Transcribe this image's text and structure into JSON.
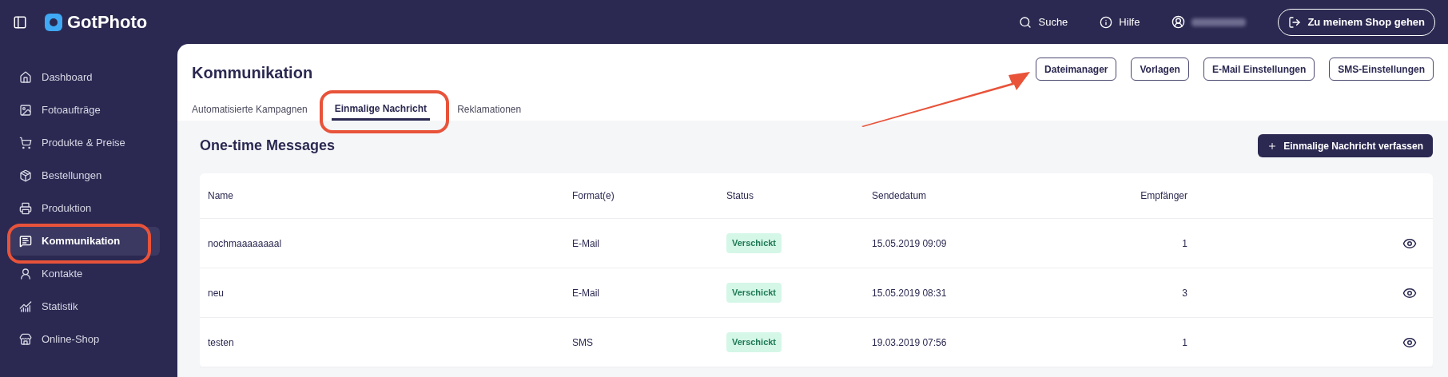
{
  "topbar": {
    "brand": "GotPhoto",
    "search": "Suche",
    "help": "Hilfe",
    "shop_button": "Zu meinem Shop gehen"
  },
  "sidebar": {
    "items": [
      {
        "label": "Dashboard",
        "selected": false
      },
      {
        "label": "Fotoaufträge",
        "selected": false
      },
      {
        "label": "Produkte & Preise",
        "selected": false
      },
      {
        "label": "Bestellungen",
        "selected": false
      },
      {
        "label": "Produktion",
        "selected": false
      },
      {
        "label": "Kommunikation",
        "selected": true
      },
      {
        "label": "Kontakte",
        "selected": false
      },
      {
        "label": "Statistik",
        "selected": false
      },
      {
        "label": "Online-Shop",
        "selected": false
      }
    ]
  },
  "page": {
    "title": "Kommunikation",
    "actions": [
      "Dateimanager",
      "Vorlagen",
      "E-Mail Einstellungen",
      "SMS-Einstellungen"
    ],
    "tabs": [
      {
        "label": "Automatisierte Kampagnen",
        "selected": false
      },
      {
        "label": "Einmalige Nachricht",
        "selected": true
      },
      {
        "label": "Reklamationen",
        "selected": false
      }
    ]
  },
  "section": {
    "title": "One-time Messages",
    "create_button": "Einmalige Nachricht verfassen"
  },
  "table": {
    "columns": [
      "Name",
      "Format(e)",
      "Status",
      "Sendedatum",
      "Empfänger"
    ],
    "rows": [
      {
        "name": "nochmaaaaaaaal",
        "format": "E-Mail",
        "status": "Verschickt",
        "date": "15.05.2019 09:09",
        "recipients": "1"
      },
      {
        "name": "neu",
        "format": "E-Mail",
        "status": "Verschickt",
        "date": "15.05.2019 08:31",
        "recipients": "3"
      },
      {
        "name": "testen",
        "format": "SMS",
        "status": "Verschickt",
        "date": "19.03.2019 07:56",
        "recipients": "1"
      }
    ]
  }
}
